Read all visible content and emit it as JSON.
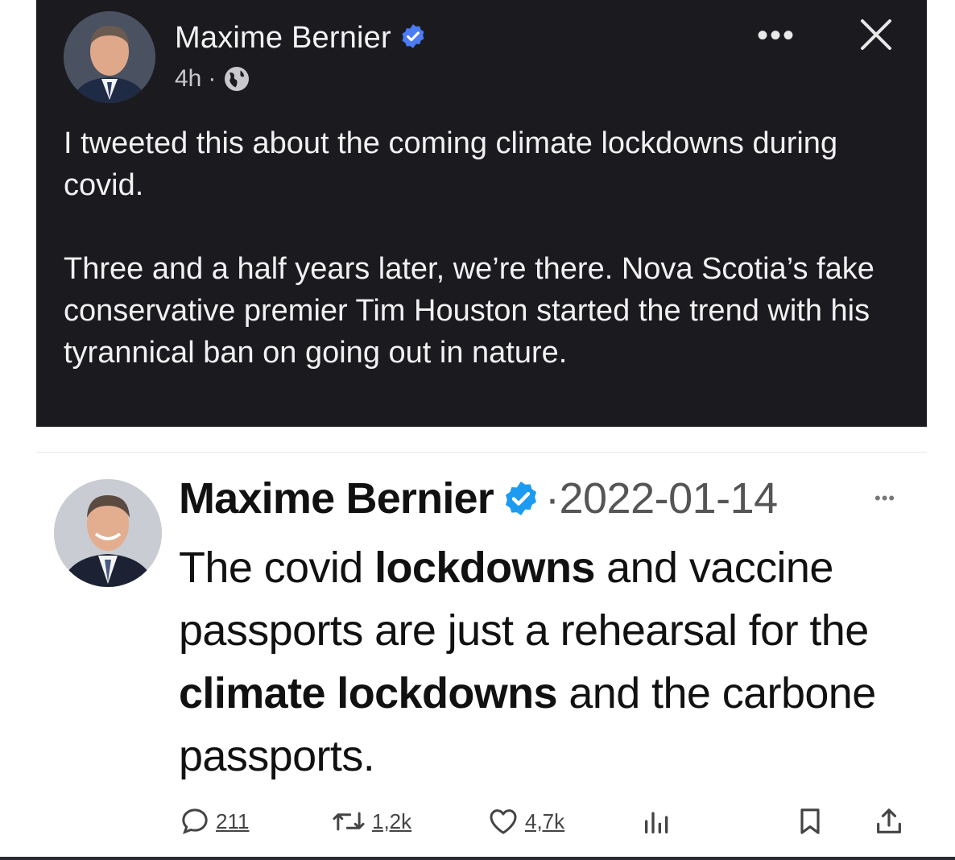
{
  "fb_post": {
    "author": "Maxime Bernier",
    "time": "4h",
    "separator": "·",
    "paragraphs": [
      "I tweeted this about the coming climate lockdowns during covid.",
      "Three and a half years later, we’re there. Nova Scotia’s fake conservative premier Tim Houston started the trend with his tyrannical ban on going out in nature."
    ],
    "more_label": "•••"
  },
  "tweet": {
    "author": "Maxime Bernier",
    "date": "·2022-01-14",
    "more_label": "•••",
    "text_segments": [
      {
        "text": "The covid ",
        "bold": false
      },
      {
        "text": "lockdowns",
        "bold": true
      },
      {
        "text": " and vaccine passports are just a rehearsal for the ",
        "bold": false
      },
      {
        "text": "climate lockdowns",
        "bold": true
      },
      {
        "text": " and the carbone passports.",
        "bold": false
      }
    ],
    "replies": "211",
    "retweets": "1,2k",
    "likes": "4,7k"
  },
  "icons": [
    "verified-badge-icon",
    "globe-icon",
    "more-icon",
    "close-icon",
    "reply-icon",
    "retweet-icon",
    "like-icon",
    "views-icon",
    "bookmark-icon",
    "share-icon"
  ],
  "colors": {
    "dark_bg": "#1b1a1f",
    "verified_blue": "#1d9bf0",
    "fb_verified": "#4b7bf5"
  }
}
